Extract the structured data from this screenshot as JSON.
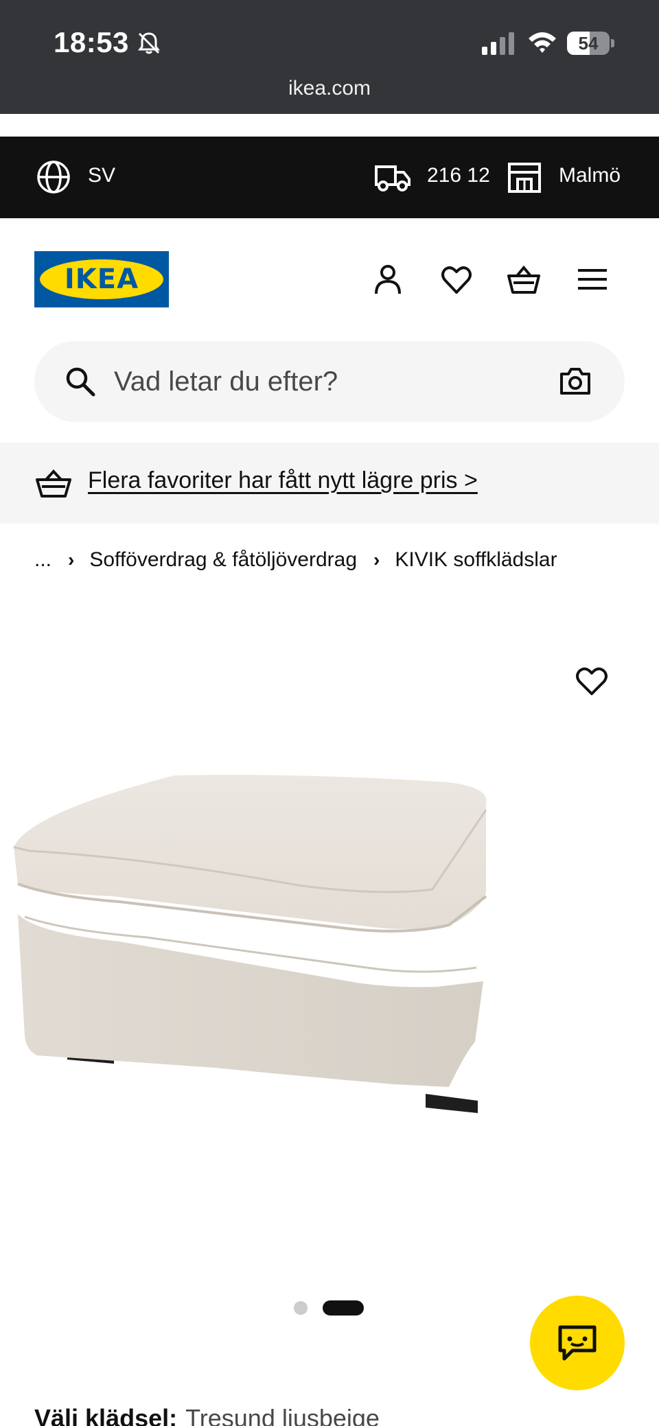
{
  "status_bar": {
    "time": "18:53",
    "battery": "54",
    "battery_level": 0.54,
    "url": "ikea.com"
  },
  "top_bar": {
    "language": "SV",
    "postal_code": "216 12",
    "store": "Malmö"
  },
  "header": {
    "logo_text": "IKEA",
    "icons": [
      "user-icon",
      "heart-icon",
      "basket-icon",
      "menu-icon"
    ]
  },
  "search": {
    "placeholder": "Vad letar du efter?"
  },
  "promo": {
    "text": "Flera favoriter har fått nytt lägre pris >"
  },
  "breadcrumb": {
    "items": [
      "...",
      "Sofföverdrag & fåtöljöverdrag",
      "KIVIK soffklädslar"
    ]
  },
  "gallery": {
    "slides": 2,
    "active_slide": 2
  },
  "product": {
    "option_label": "Välj klädsel:",
    "option_value": "Tresund ljusbeige"
  },
  "colors": {
    "brand_blue": "#0058a3",
    "brand_yellow": "#ffdb00",
    "dark": "#111111"
  }
}
